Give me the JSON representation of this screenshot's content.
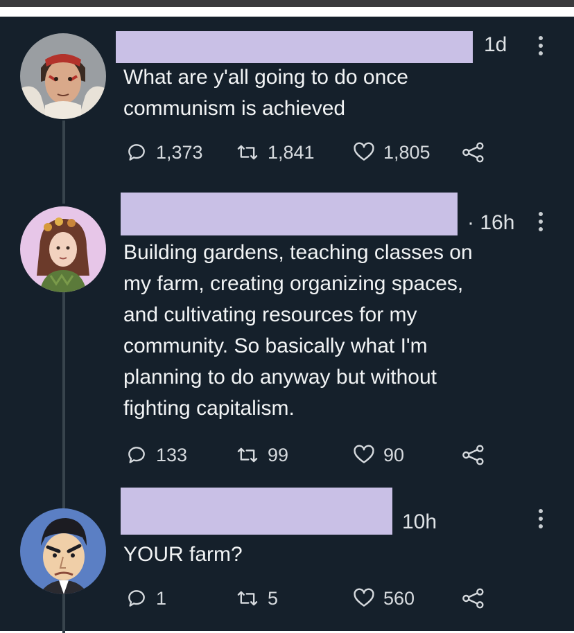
{
  "tweets": [
    {
      "time": "1d",
      "text_lines": [
        "What are y'all going to do once",
        "communism is achieved"
      ],
      "replies": "1,373",
      "retweets": "1,841",
      "likes": "1,805"
    },
    {
      "time": "· 16h",
      "text_lines": [
        "Building gardens, teaching classes on",
        "my farm,  creating organizing spaces,",
        "and cultivating resources for my",
        "community. So basically what I'm",
        "planning to do anyway but without",
        "fighting capitalism."
      ],
      "replies": "133",
      "retweets": "99",
      "likes": "90"
    },
    {
      "time": "10h",
      "text_lines": [
        "YOUR farm?"
      ],
      "replies": "1",
      "retweets": "5",
      "likes": "560"
    }
  ],
  "colors": {
    "background": "#15202b",
    "redaction": "#c9c0e6",
    "text": "#f2f4f5",
    "icon": "#d6dade"
  },
  "icons": {
    "reply": "reply-icon",
    "retweet": "retweet-icon",
    "like": "heart-icon",
    "share": "share-icon",
    "more": "more-vertical-icon"
  }
}
